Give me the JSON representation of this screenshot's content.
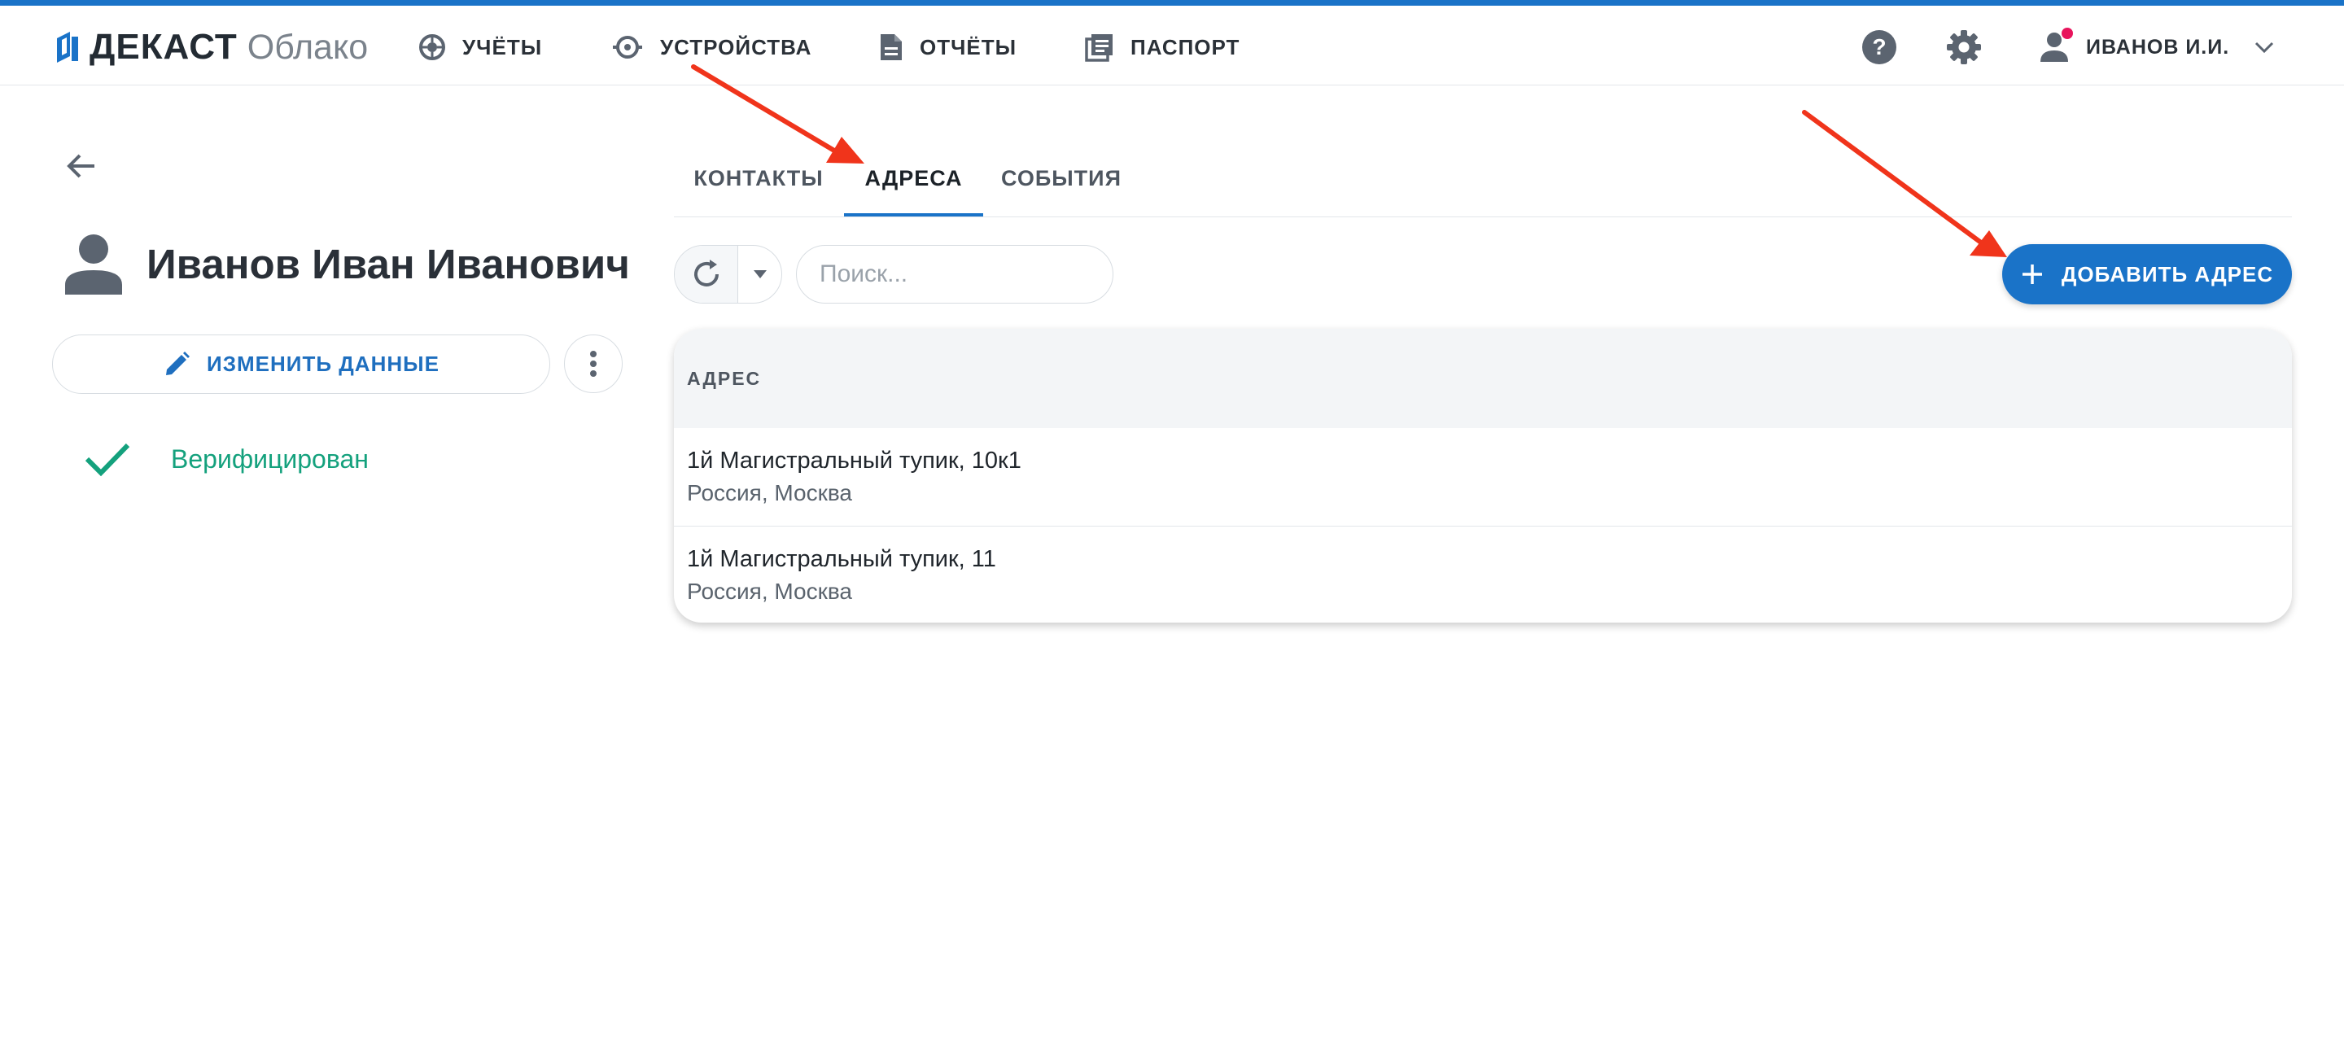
{
  "colors": {
    "accent": "#1a73c8",
    "verified": "#14a17d",
    "annotation_arrow": "#f0341b",
    "notification_dot": "#e8145c"
  },
  "logo": {
    "brand": "ДЕКАСТ",
    "product": "Облако"
  },
  "nav": [
    {
      "label": "УЧЁТЫ",
      "icon": "meter-icon"
    },
    {
      "label": "УСТРОЙСТВА",
      "icon": "device-icon"
    },
    {
      "label": "ОТЧЁТЫ",
      "icon": "report-icon"
    },
    {
      "label": "ПАСПОРТ",
      "icon": "passport-icon"
    }
  ],
  "header": {
    "user_name": "ИВАНОВ И.И.",
    "icons": [
      "help-icon",
      "settings-icon",
      "user-icon",
      "chevron-down-icon"
    ]
  },
  "profile": {
    "name": "Иванов Иван Иванович",
    "edit_label": "ИЗМЕНИТЬ ДАННЫЕ",
    "status": "Верифицирован"
  },
  "tabs": [
    {
      "label": "КОНТАКТЫ",
      "active": false
    },
    {
      "label": "АДРЕСА",
      "active": true
    },
    {
      "label": "СОБЫТИЯ",
      "active": false
    }
  ],
  "toolbar": {
    "search_placeholder": "Поиск...",
    "add_label": "ДОБАВИТЬ АДРЕС"
  },
  "table": {
    "column": "АДРЕС",
    "rows": [
      {
        "line1": "1й Магистральный тупик, 10к1",
        "line2": "Россия, Москва"
      },
      {
        "line1": "1й Магистральный тупик, 11",
        "line2": "Россия, Москва"
      }
    ]
  }
}
